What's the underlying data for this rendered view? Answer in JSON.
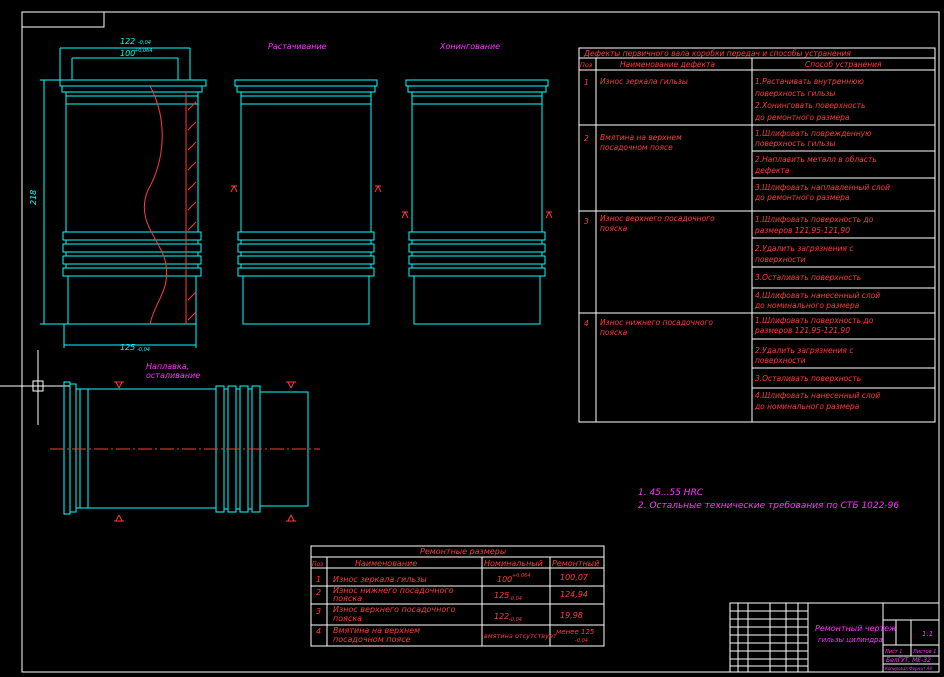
{
  "labels": {
    "top_dim_122": "122",
    "top_dim_122_tol": "-0,04",
    "top_dim_100": "100",
    "top_dim_100_tol": "+0,064",
    "left_dim_218": "218",
    "bottom_dim_125": "125",
    "bottom_dim_125_tol": "-0,04",
    "boring": "Растачивание",
    "honing": "Хонингование",
    "surfacing_line1": "Наплавка,",
    "surfacing_line2": "осталивание"
  },
  "defects_table": {
    "title": "Дефекты первичного вала коробки передач и способы устранения",
    "headers": [
      "Поз",
      "Наименование дефекта",
      "Способ устранения"
    ],
    "rows": [
      {
        "num": "1",
        "name_line1": "Износ зеркала гильзы",
        "name_line2": "",
        "methods": [
          [
            "1.Растачивать внутреннюю",
            "поверхность гильзы"
          ],
          [
            "2.Хонинговать поверхность",
            "до ремонтного размера"
          ]
        ]
      },
      {
        "num": "2",
        "name_line1": "Вмятина на верхнем",
        "name_line2": "посадочном поясе",
        "methods": [
          [
            "1.Шлифовать поврежденную",
            "поверхность гильзы"
          ],
          [
            "2.Наплавить металл в область",
            "дефекта"
          ],
          [
            "3.Шлифовать наплавленный слой",
            "до ремонтного размера"
          ]
        ]
      },
      {
        "num": "3",
        "name_line1": "Износ верхнего посадочного",
        "name_line2": "пояска",
        "methods": [
          [
            "1.Шлифовать поверхность до",
            "размеров 121,95-121,90"
          ],
          [
            "2.Удалить загрязнения с",
            "поверхности"
          ],
          [
            "3.Осталивать поверхность",
            ""
          ],
          [
            "4.Шлифовать нанесенный слой",
            "до номинального размера"
          ]
        ]
      },
      {
        "num": "4",
        "name_line1": "Износ нижнего посадочного",
        "name_line2": "пояска",
        "methods": [
          [
            "1.Шлифовать поверхность до",
            "размеров 121,95-121,90"
          ],
          [
            "2.Удалить загрязнения с",
            "поверхности"
          ],
          [
            "3.Осталивать поверхность",
            ""
          ],
          [
            "4.Шлифовать нанесенный слой",
            "до номинального размера"
          ]
        ]
      }
    ]
  },
  "notes": {
    "note1": "1. 45...55 HRC",
    "note2": "2. Остальные технические требования по СТБ 1022-96"
  },
  "repair_table": {
    "title": "Ремонтные размеры",
    "headers": [
      "Поз",
      "Наименование",
      "Номинальный",
      "Ремонтный"
    ],
    "rows": [
      {
        "num": "1",
        "name_line1": "Износ зеркала гильзы",
        "name_line2": "",
        "nominal": "100",
        "nominal_tol": "+0,064",
        "repair": "100,07",
        "repair_tol": ""
      },
      {
        "num": "2",
        "name_line1": "Износ нижнего посадочного",
        "name_line2": "пояска",
        "nominal": "125",
        "nominal_tol": "-0,04",
        "repair": "124,94",
        "repair_tol": ""
      },
      {
        "num": "3",
        "name_line1": "Износ верхнего посадочного",
        "name_line2": "пояска",
        "nominal": "122",
        "nominal_tol": "-0,04",
        "repair": "19,98",
        "repair_tol": ""
      },
      {
        "num": "4",
        "name_line1": "Вмятина на верхнем",
        "name_line2": "посадочном поясе",
        "nominal": "вмятина отсутствует",
        "nominal_tol": "",
        "repair": "менее 125",
        "repair_tol": "-0,04"
      }
    ]
  },
  "title_block": {
    "drawing_title_line1": "Ремонтный чертеж",
    "drawing_title_line2": "гильзы цилиндра",
    "scale": "1:1",
    "sheet": "Лист 1",
    "sheets": "Листов 1",
    "org": "БелГУТ, МЕ-32",
    "format": "Копировал   Формат А4"
  },
  "colors": {
    "line": "#00ffff",
    "text": "#ff3b3b",
    "label": "#ff33ff",
    "frame": "#ffffff"
  }
}
